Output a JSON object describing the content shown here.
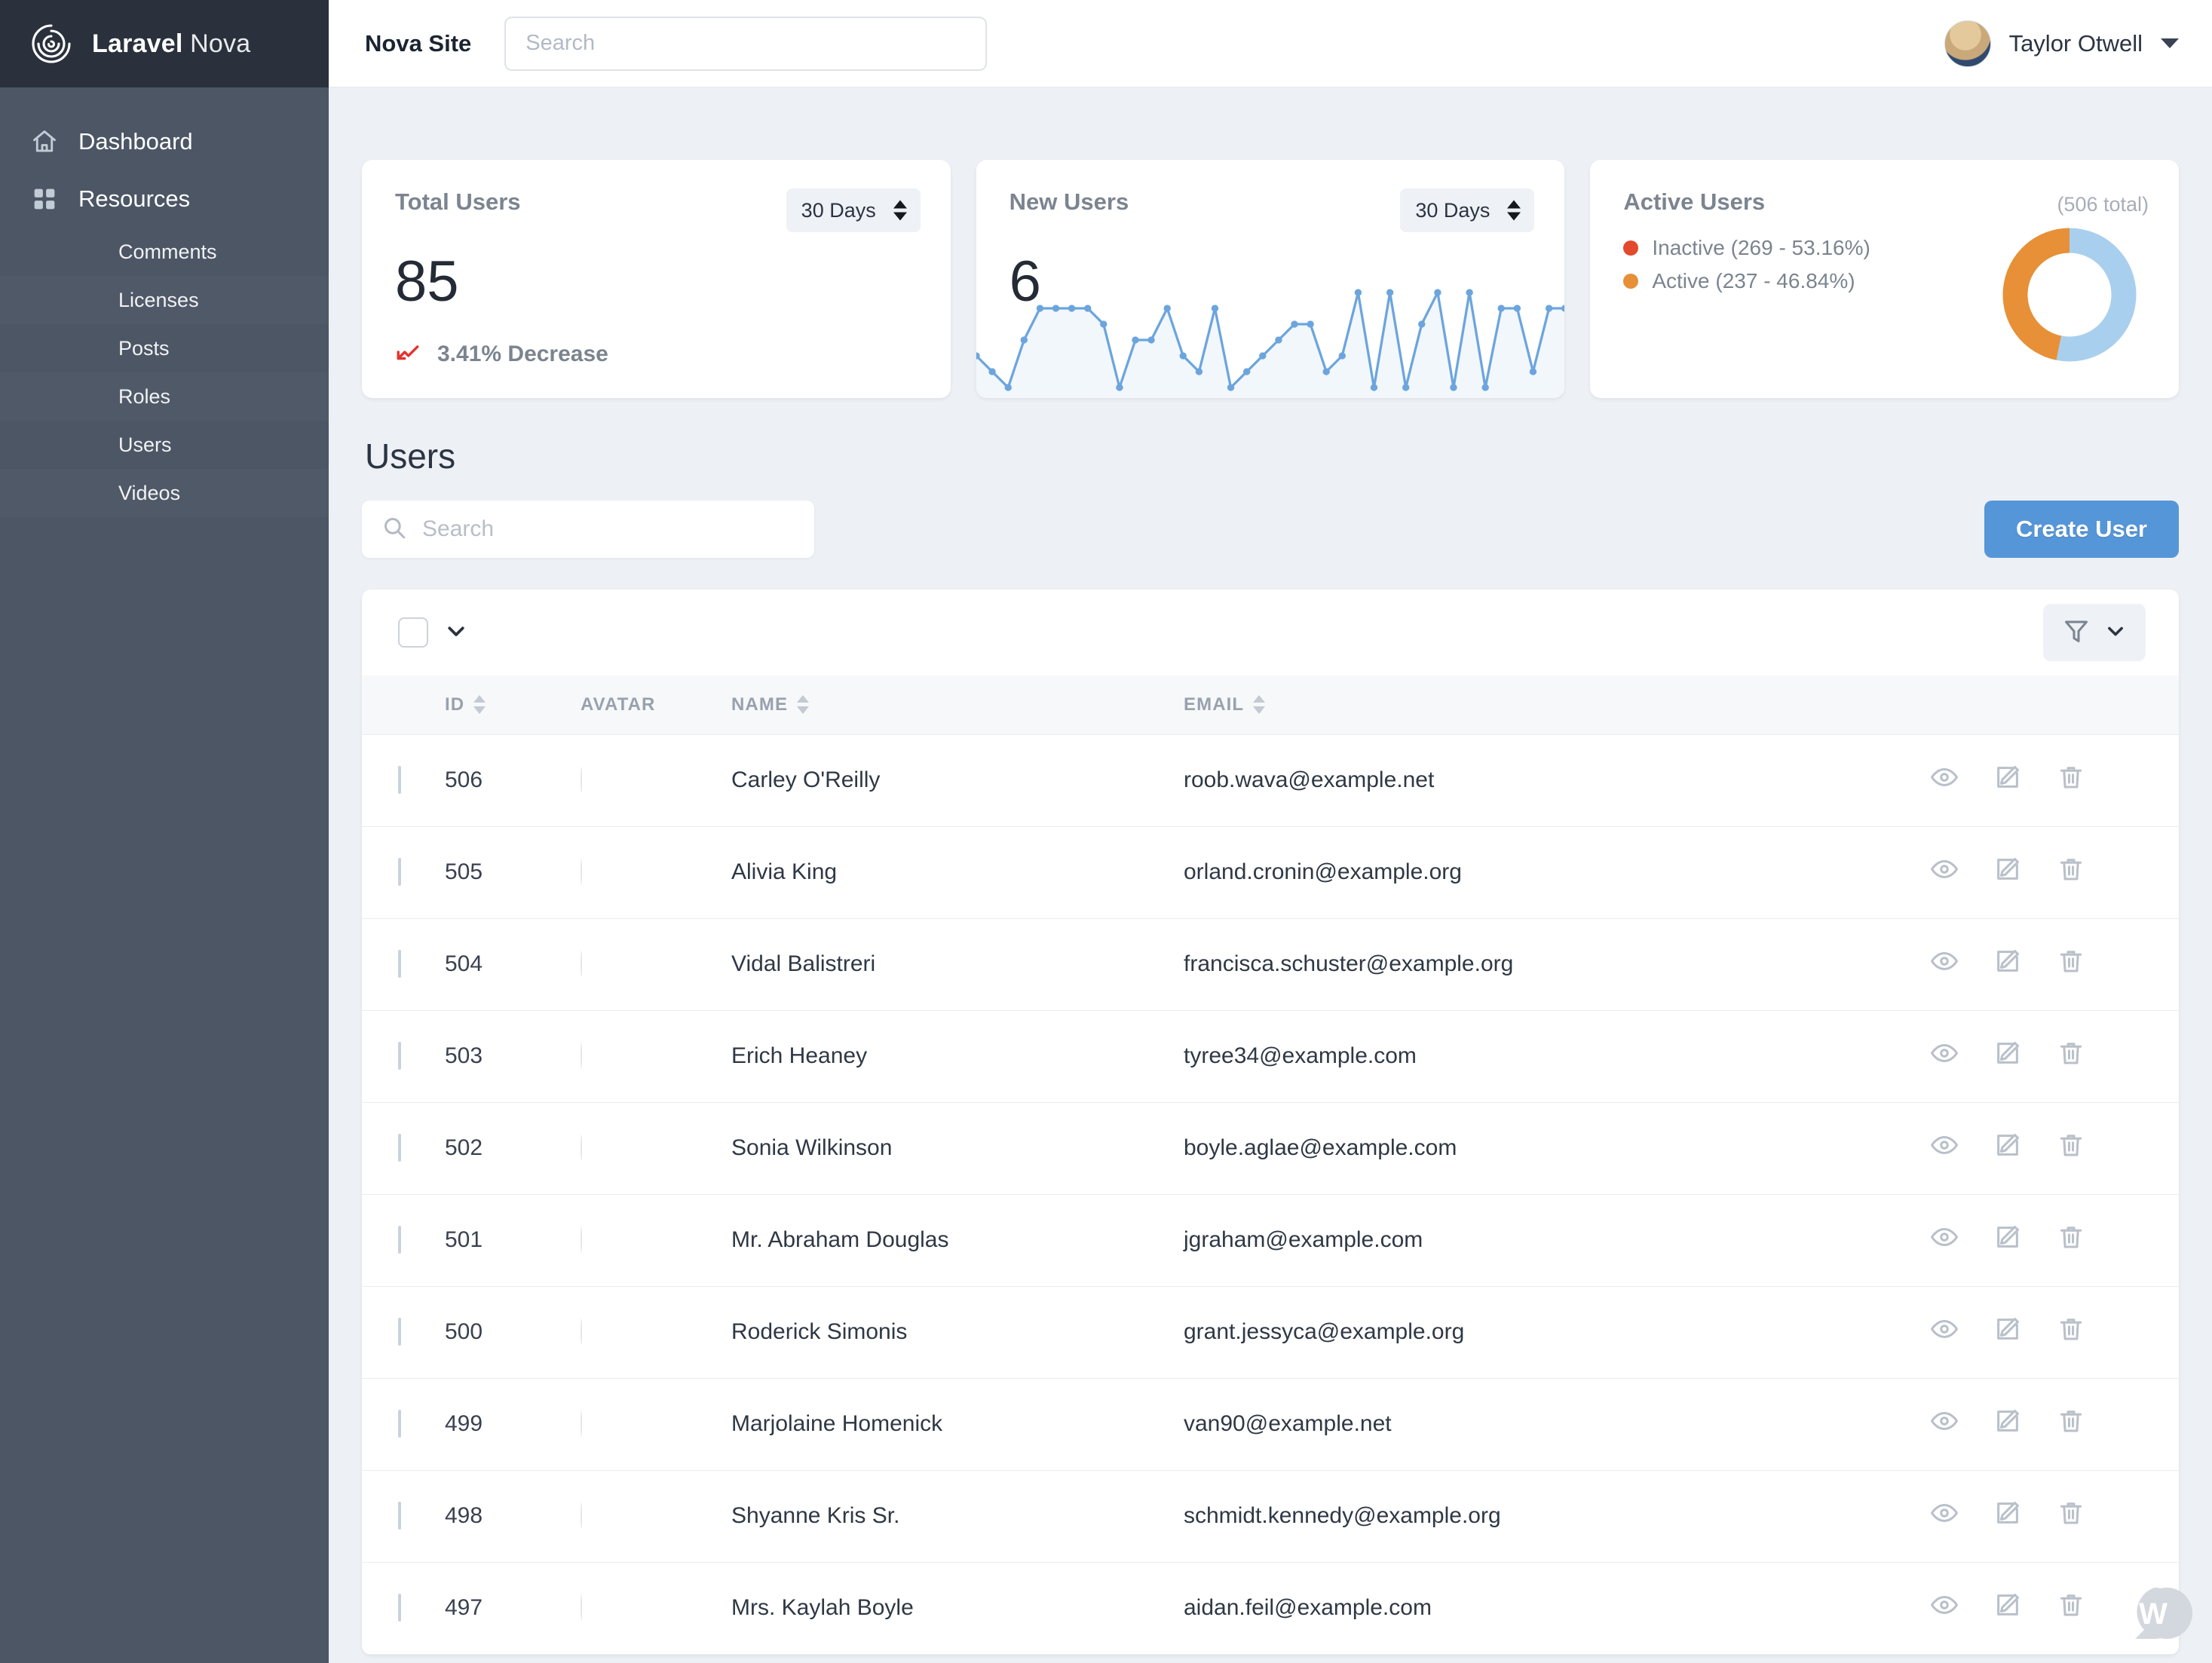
{
  "brand": {
    "name_bold": "Laravel",
    "name_light": "Nova",
    "logo_icon": "spiral-logo-icon"
  },
  "sidebar": {
    "items": [
      {
        "label": "Dashboard",
        "icon": "home-icon"
      },
      {
        "label": "Resources",
        "icon": "grid-icon"
      }
    ],
    "resources": [
      {
        "label": "Comments"
      },
      {
        "label": "Licenses"
      },
      {
        "label": "Posts"
      },
      {
        "label": "Roles"
      },
      {
        "label": "Users"
      },
      {
        "label": "Videos"
      }
    ]
  },
  "topbar": {
    "site_title": "Nova Site",
    "search_placeholder": "Search",
    "search_value": "",
    "user_name": "Taylor Otwell",
    "chevron_icon": "chevron-down-icon",
    "avatar_icon": "user-avatar"
  },
  "metrics": {
    "total_users": {
      "title": "Total Users",
      "range": "30 Days",
      "value": "85",
      "trend_text": "3.41% Decrease",
      "trend_icon": "trend-down-icon",
      "trend_color": "#e3342f"
    },
    "new_users": {
      "title": "New Users",
      "range": "30 Days",
      "value": "6"
    },
    "active_users": {
      "title": "Active Users",
      "total_label": "(506 total)",
      "legend": [
        {
          "label": "Inactive (269 - 53.16%)",
          "dot_color": "#e3492c"
        },
        {
          "label": "Active (237 - 46.84%)",
          "dot_color": "#e79038"
        }
      ]
    }
  },
  "chart_data": [
    {
      "type": "line",
      "title": "New Users",
      "name": "new-users-sparkline",
      "xlabel": "",
      "ylabel": "",
      "grid": false,
      "legend": "none",
      "line_color": "#6ca5dd",
      "fill_color": "#f2f7fc",
      "x": [
        1,
        2,
        3,
        4,
        5,
        6,
        7,
        8,
        9,
        10,
        11,
        12,
        13,
        14,
        15,
        16,
        17,
        18,
        19,
        20,
        21,
        22,
        23,
        24,
        25,
        26,
        27,
        28,
        29,
        30,
        31,
        32,
        33,
        34,
        35,
        36,
        37,
        38
      ],
      "values": [
        2,
        1,
        0,
        3,
        5,
        5,
        5,
        5,
        4,
        0,
        3,
        3,
        5,
        2,
        1,
        5,
        0,
        1,
        2,
        3,
        4,
        4,
        1,
        2,
        6,
        0,
        6,
        0,
        4,
        6,
        0,
        6,
        0,
        5,
        5,
        1,
        5,
        5
      ],
      "ylim": [
        0,
        6
      ]
    },
    {
      "type": "pie",
      "title": "Active Users",
      "name": "active-users-donut",
      "labels": [
        "Inactive",
        "Active"
      ],
      "values": [
        269,
        237
      ],
      "percents": [
        53.16,
        46.84
      ],
      "total": 506,
      "slice_colors": [
        "#a9cfee",
        "#e79038"
      ],
      "donut": true,
      "legend": "left"
    }
  ],
  "users_section": {
    "heading": "Users",
    "search_placeholder": "Search",
    "search_value": "",
    "create_button": "Create User",
    "filter_icon": "filter-icon",
    "select_all_icon": "checkbox",
    "toolbar_chevron_icon": "chevron-down-icon"
  },
  "table": {
    "columns": [
      "ID",
      "AVATAR",
      "NAME",
      "EMAIL"
    ],
    "row_actions": [
      {
        "name": "view-icon",
        "title": "View"
      },
      {
        "name": "edit-icon",
        "title": "Edit"
      },
      {
        "name": "delete-icon",
        "title": "Delete"
      }
    ],
    "rows": [
      {
        "id": "506",
        "name": "Carley O'Reilly",
        "email": "roob.wava@example.net",
        "avatar_colors": [
          "#6d4a52",
          "#2e1b22"
        ]
      },
      {
        "id": "505",
        "name": "Alivia King",
        "email": "orland.cronin@example.org",
        "avatar_colors": [
          "#e0a878",
          "#8a4f30"
        ]
      },
      {
        "id": "504",
        "name": "Vidal Balistreri",
        "email": "francisca.schuster@example.org",
        "avatar_colors": [
          "#ded7d8",
          "#5b4a48"
        ]
      },
      {
        "id": "503",
        "name": "Erich Heaney",
        "email": "tyree34@example.com",
        "avatar_colors": [
          "#dcc8a8",
          "#9a7c54"
        ]
      },
      {
        "id": "502",
        "name": "Sonia Wilkinson",
        "email": "boyle.aglae@example.com",
        "avatar_colors": [
          "#d98b64",
          "#7b3f28"
        ]
      },
      {
        "id": "501",
        "name": "Mr. Abraham Douglas",
        "email": "jgraham@example.com",
        "avatar_colors": [
          "#3b2a24",
          "#c4a389"
        ]
      },
      {
        "id": "500",
        "name": "Roderick Simonis",
        "email": "grant.jessyca@example.org",
        "avatar_colors": [
          "#c9b08c",
          "#32211d"
        ]
      },
      {
        "id": "499",
        "name": "Marjolaine Homenick",
        "email": "van90@example.net",
        "avatar_colors": [
          "#d79a70",
          "#6d4327"
        ]
      },
      {
        "id": "498",
        "name": "Shyanne Kris Sr.",
        "email": "schmidt.kennedy@example.org",
        "avatar_colors": [
          "#d4805a",
          "#7a3a22"
        ]
      },
      {
        "id": "497",
        "name": "Mrs. Kaylah Boyle",
        "email": "aidan.feil@example.com",
        "avatar_colors": [
          "#c98f63",
          "#2e1f18"
        ]
      }
    ]
  },
  "chat_widget": {
    "icon": "chat-bubble-w-icon"
  }
}
